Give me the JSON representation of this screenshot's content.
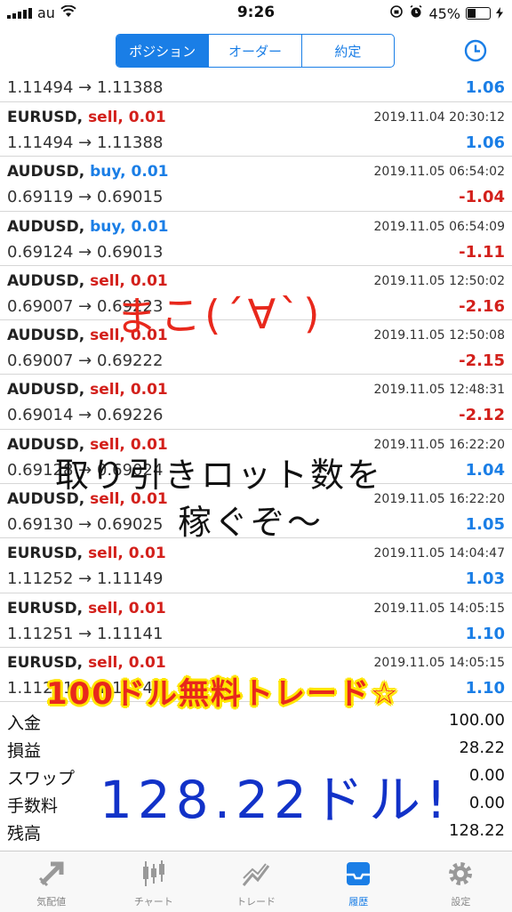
{
  "status": {
    "carrier": "au",
    "time": "9:26",
    "battery": "45%",
    "battery_level": 0.45
  },
  "tabs_segment": [
    {
      "label": "ポジション",
      "active": true
    },
    {
      "label": "オーダー",
      "active": false
    },
    {
      "label": "約定",
      "active": false
    }
  ],
  "partial_row": {
    "prices": "1.11494 → 1.11388",
    "profit": "1.06"
  },
  "trades": [
    {
      "symbol": "EURUSD",
      "side": "sell",
      "lots": "0.01",
      "time": "2019.11.04 20:30:12",
      "prices": "1.11494 → 1.11388",
      "profit": "1.06"
    },
    {
      "symbol": "AUDUSD",
      "side": "buy",
      "lots": "0.01",
      "time": "2019.11.05 06:54:02",
      "prices": "0.69119 → 0.69015",
      "profit": "-1.04"
    },
    {
      "symbol": "AUDUSD",
      "side": "buy",
      "lots": "0.01",
      "time": "2019.11.05 06:54:09",
      "prices": "0.69124 → 0.69013",
      "profit": "-1.11"
    },
    {
      "symbol": "AUDUSD",
      "side": "sell",
      "lots": "0.01",
      "time": "2019.11.05 12:50:02",
      "prices": "0.69007 → 0.69223",
      "profit": "-2.16"
    },
    {
      "symbol": "AUDUSD",
      "side": "sell",
      "lots": "0.01",
      "time": "2019.11.05 12:50:08",
      "prices": "0.69007 → 0.69222",
      "profit": "-2.15"
    },
    {
      "symbol": "AUDUSD",
      "side": "sell",
      "lots": "0.01",
      "time": "2019.11.05 12:48:31",
      "prices": "0.69014 → 0.69226",
      "profit": "-2.12"
    },
    {
      "symbol": "AUDUSD",
      "side": "sell",
      "lots": "0.01",
      "time": "2019.11.05 16:22:20",
      "prices": "0.69128 → 0.69024",
      "profit": "1.04"
    },
    {
      "symbol": "AUDUSD",
      "side": "sell",
      "lots": "0.01",
      "time": "2019.11.05 16:22:20",
      "prices": "0.69130 → 0.69025",
      "profit": "1.05"
    },
    {
      "symbol": "EURUSD",
      "side": "sell",
      "lots": "0.01",
      "time": "2019.11.05 14:04:47",
      "prices": "1.11252 → 1.11149",
      "profit": "1.03"
    },
    {
      "symbol": "EURUSD",
      "side": "sell",
      "lots": "0.01",
      "time": "2019.11.05 14:05:15",
      "prices": "1.11251 → 1.11141",
      "profit": "1.10"
    },
    {
      "symbol": "EURUSD",
      "side": "sell",
      "lots": "0.01",
      "time": "2019.11.05 14:05:15",
      "prices": "1.11251 → 1.11141",
      "profit": "1.10"
    }
  ],
  "summary": [
    {
      "label": "入金",
      "value": "100.00"
    },
    {
      "label": "損益",
      "value": "28.22"
    },
    {
      "label": "スワップ",
      "value": "0.00"
    },
    {
      "label": "手数料",
      "value": "0.00"
    },
    {
      "label": "残高",
      "value": "128.22"
    }
  ],
  "tabbar": [
    {
      "label": "気配値",
      "icon": "quotes-icon",
      "active": false
    },
    {
      "label": "チャート",
      "icon": "candlestick-icon",
      "active": false
    },
    {
      "label": "トレード",
      "icon": "trade-icon",
      "active": false
    },
    {
      "label": "履歴",
      "icon": "history-inbox-icon",
      "active": true
    },
    {
      "label": "設定",
      "icon": "gear-icon",
      "active": false
    }
  ],
  "annotations": {
    "face": "まこ(´∀`)",
    "line1": "取り引きロット数を",
    "line2": "稼ぐぞ〜",
    "banner": "100ドル無料トレード☆",
    "total": "128.22ドル!"
  },
  "colors": {
    "accent": "#1a7ee6",
    "loss": "#d3201b",
    "banner_text": "#e8281c",
    "banner_glow": "#ffe500",
    "total_ink": "#1232c8"
  }
}
